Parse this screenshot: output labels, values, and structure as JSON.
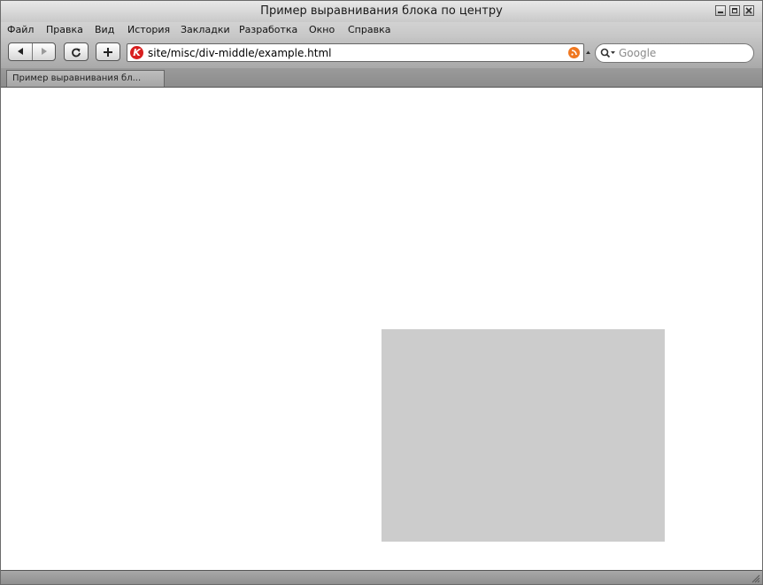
{
  "window": {
    "title": "Пример выравнивания блока по центру"
  },
  "menubar": {
    "items": [
      "Файл",
      "Правка",
      "Вид",
      "История",
      "Закладки",
      "Разработка",
      "Окно",
      "Справка"
    ]
  },
  "toolbar": {
    "url": "site/misc/div-middle/example.html",
    "site_icon_letter": "K",
    "search_placeholder": "Google"
  },
  "tabs": [
    {
      "label": "Пример выравнивания бл..."
    }
  ],
  "colors": {
    "block": "#cccccc",
    "site_icon": "#d81f1f",
    "rss_icon": "#f07820"
  },
  "icons": {
    "back": "back-arrow-icon",
    "forward": "forward-arrow-icon",
    "reload": "reload-icon",
    "add": "plus-icon",
    "search": "magnifier-icon",
    "rss": "rss-icon"
  }
}
